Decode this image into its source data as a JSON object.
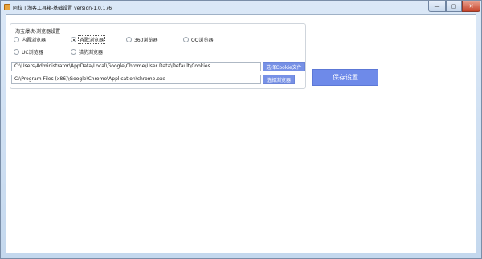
{
  "window": {
    "title": "阿拉丁淘客工具箱-基础设置 version-1.0.176",
    "min_symbol": "—",
    "max_symbol": "▢",
    "close_symbol": "✕"
  },
  "group": {
    "title": "淘宝爆块-浏览器设置",
    "radios": [
      {
        "label": "内置浏览器",
        "checked": false
      },
      {
        "label": "谷歌浏览器",
        "checked": true
      },
      {
        "label": "360浏览器",
        "checked": false
      },
      {
        "label": "QQ浏览器",
        "checked": false
      },
      {
        "label": "UC浏览器",
        "checked": false
      },
      {
        "label": "猎豹浏览器",
        "checked": false
      }
    ],
    "cookie_path": "C:\\Users\\Administrator\\AppData\\Local\\Google\\Chrome\\User Data\\Default\\Cookies",
    "choose_cookie_label": "选择Cookie文件",
    "browser_path": "C:\\Program Files (x86)\\Google\\Chrome\\Application\\chrome.exe",
    "choose_browser_label": "选择浏览器"
  },
  "save_label": "保存设置",
  "colors": {
    "accent_button": "#7791e6",
    "close_button": "#c7442a"
  }
}
